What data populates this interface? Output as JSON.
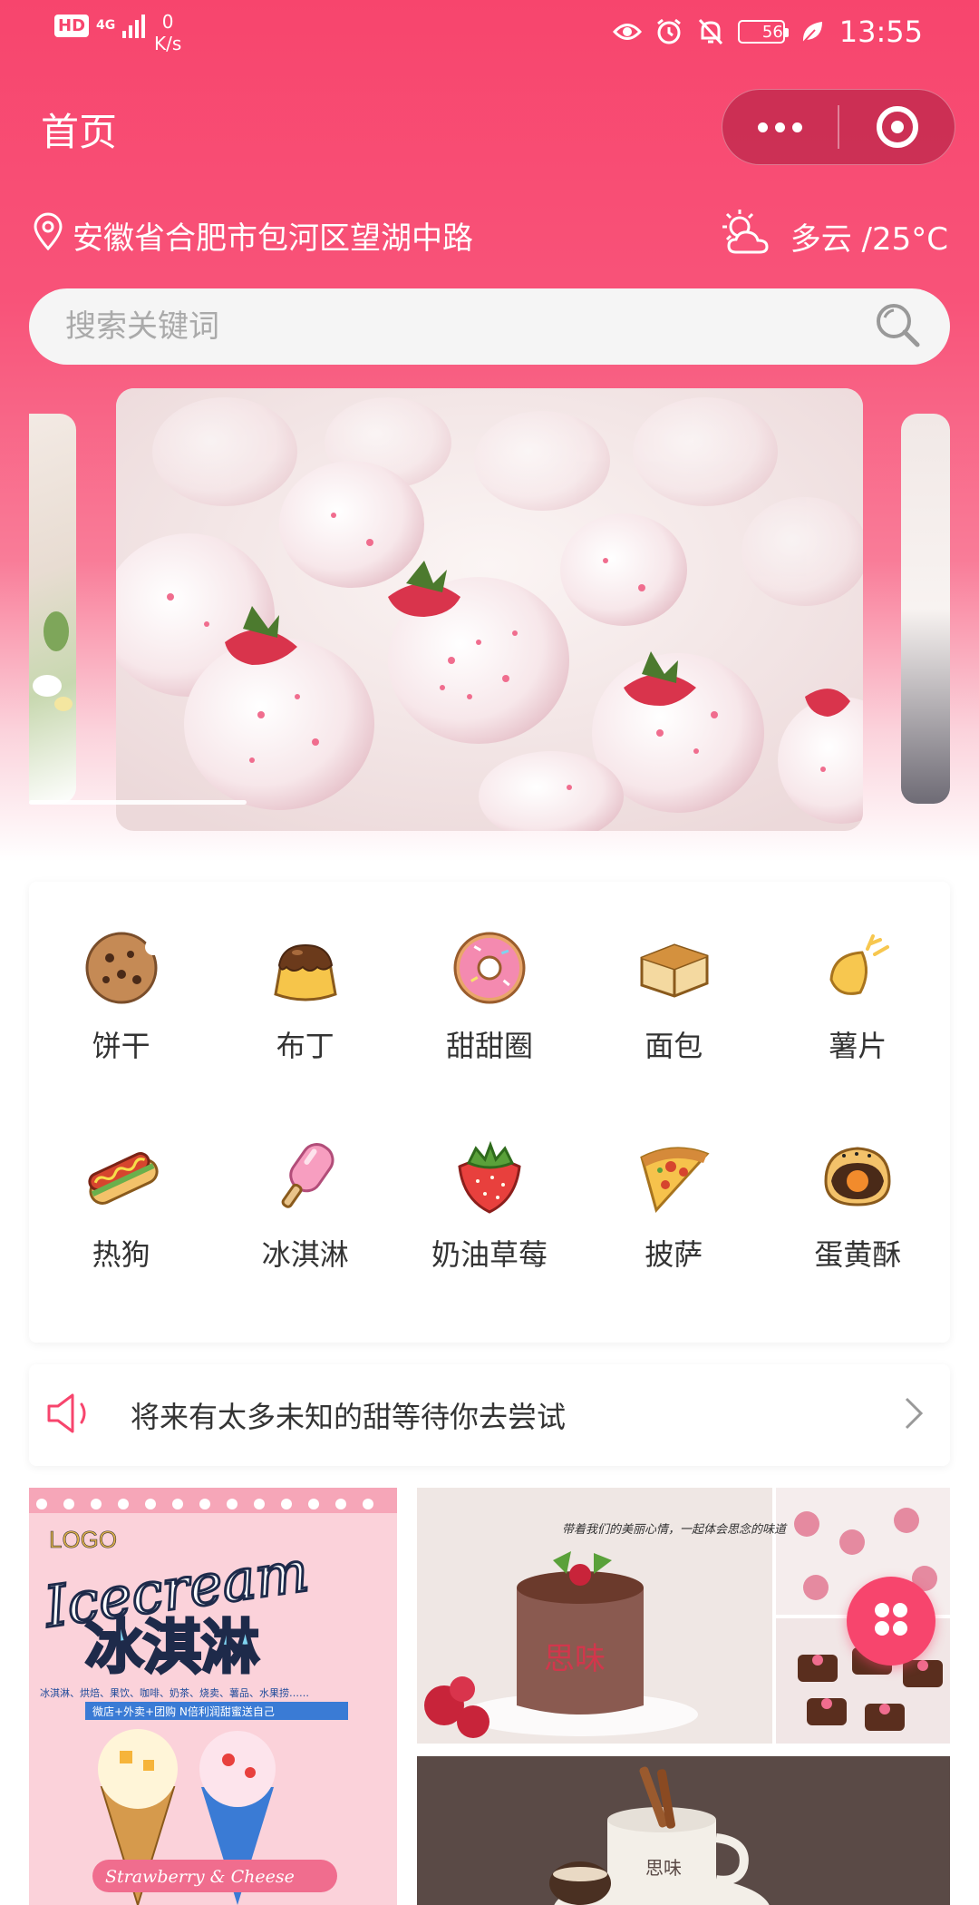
{
  "status_bar": {
    "hd": "HD",
    "network": "4G",
    "speed_value": "0",
    "speed_unit": "K/s",
    "battery": "56",
    "time": "13:55"
  },
  "nav": {
    "title": "首页",
    "capsule_icons": [
      "more-dots-icon",
      "target-icon"
    ]
  },
  "location": {
    "address": "安徽省合肥市包河区望湖中路",
    "icon": "location-pin-icon"
  },
  "weather": {
    "text": "多云 /25°C",
    "icon": "partly-cloudy-icon"
  },
  "search": {
    "placeholder": "搜索关键词",
    "icon": "search-icon"
  },
  "categories": [
    {
      "label": "饼干",
      "icon": "cookie-icon"
    },
    {
      "label": "布丁",
      "icon": "pudding-icon"
    },
    {
      "label": "甜甜圈",
      "icon": "donut-icon"
    },
    {
      "label": "面包",
      "icon": "bread-icon"
    },
    {
      "label": "薯片",
      "icon": "chips-icon"
    },
    {
      "label": "热狗",
      "icon": "hotdog-icon"
    },
    {
      "label": "冰淇淋",
      "icon": "ice-cream-icon"
    },
    {
      "label": "奶油草莓",
      "icon": "strawberry-icon"
    },
    {
      "label": "披萨",
      "icon": "pizza-icon"
    },
    {
      "label": "蛋黄酥",
      "icon": "egg-yolk-pastry-icon"
    }
  ],
  "notice": {
    "text": "将来有太多未知的甜等待你去尝试",
    "icon": "speaker-icon"
  },
  "promo_tiles": {
    "ice_cream": {
      "logo": "LOGO",
      "title_en": "Icecream",
      "title_cn": "冰淇淋",
      "line": "冰淇淋、烘焙、果饮、咖啡、奶茶、烧卖、薯品、水果捞……",
      "sub": "微店+外卖+团购  N倍利润甜蜜送自己",
      "flavor": "Strawberry & Cheese"
    },
    "cake": {
      "tagline": "带着我们的美丽心情，一起体会思念的味道",
      "brand": "思味"
    },
    "coffee": {
      "brand": "思味"
    }
  },
  "colors": {
    "primary": "#f7456d",
    "text": "#333333",
    "placeholder": "#aaaaaa"
  }
}
